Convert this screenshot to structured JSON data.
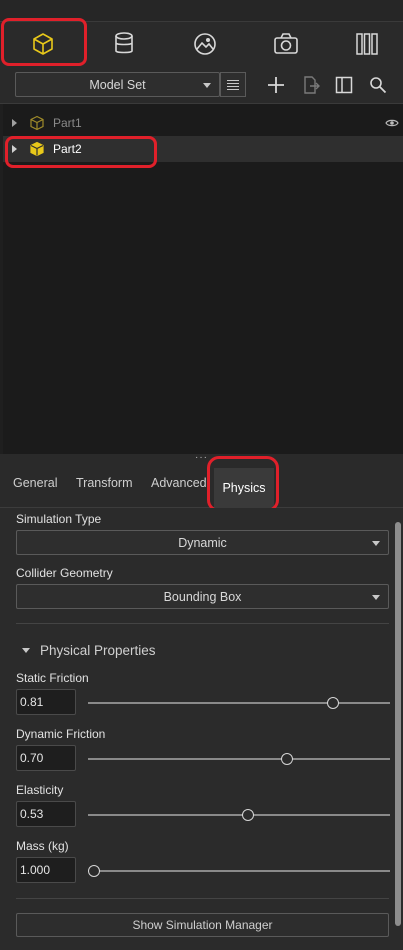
{
  "toolbar": {
    "icons": [
      "model-cube-icon",
      "database-icon",
      "image-icon",
      "camera-icon",
      "library-icon"
    ]
  },
  "model_set": {
    "dropdown_value": "Model Set",
    "actions": [
      "list-icon",
      "add-icon",
      "export-icon",
      "panel-icon",
      "search-icon"
    ]
  },
  "tree": {
    "items": [
      {
        "label": "Part1",
        "selected": false,
        "visibility_icon": "eye-icon"
      },
      {
        "label": "Part2",
        "selected": true
      }
    ]
  },
  "tabs": {
    "items": [
      "General",
      "Transform",
      "Advanced",
      "Physics"
    ],
    "active": "Physics"
  },
  "physics": {
    "simulation_type_label": "Simulation Type",
    "simulation_type_value": "Dynamic",
    "collider_label": "Collider Geometry",
    "collider_value": "Bounding Box",
    "section_title": "Physical Properties",
    "properties": [
      {
        "label": "Static Friction",
        "value": "0.81",
        "level": 0.81
      },
      {
        "label": "Dynamic Friction",
        "value": "0.70",
        "level": 0.66
      },
      {
        "label": "Elasticity",
        "value": "0.53",
        "level": 0.53
      },
      {
        "label": "Mass (kg)",
        "value": "1.000",
        "level": 0.02
      }
    ],
    "manager_button": "Show Simulation Manager"
  },
  "colors": {
    "highlight": "#e0202a",
    "cube_yellow": "#e8c81a"
  }
}
